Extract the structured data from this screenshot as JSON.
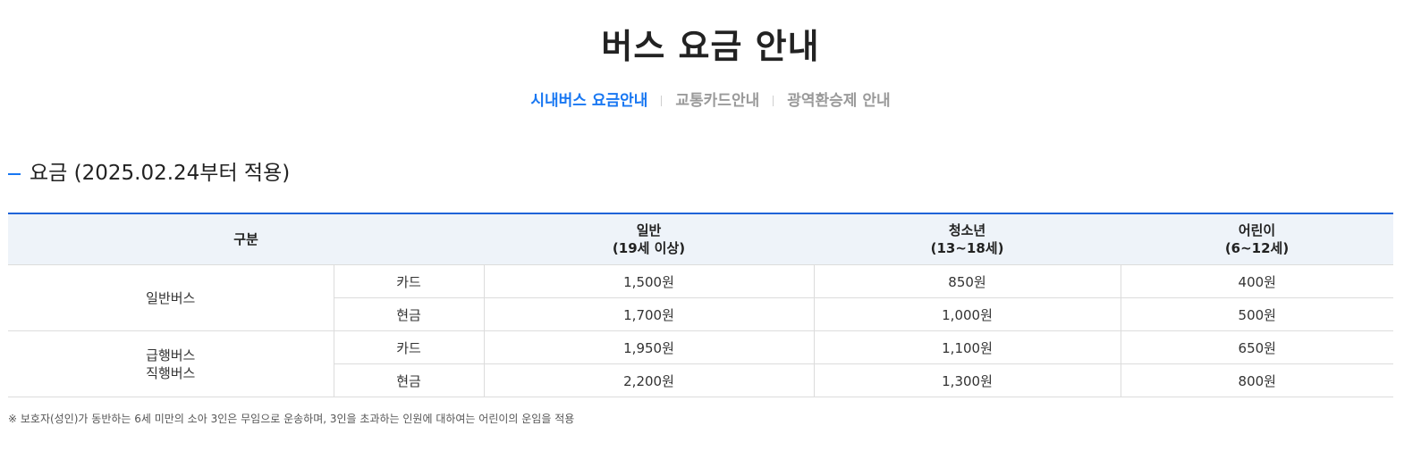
{
  "page": {
    "title": "버스 요금 안내"
  },
  "tabs": [
    {
      "label": "시내버스 요금안내",
      "active": true
    },
    {
      "label": "교통카드안내",
      "active": false
    },
    {
      "label": "광역환승제 안내",
      "active": false
    }
  ],
  "section": {
    "title": "요금 (2025.02.24부터 적용)"
  },
  "table": {
    "header": {
      "category": "구분",
      "general_line1": "일반",
      "general_line2": "(19세 이상)",
      "youth_line1": "청소년",
      "youth_line2": "(13~18세)",
      "child_line1": "어린이",
      "child_line2": "(6~12세)"
    },
    "groups": [
      {
        "label_line1": "일반버스",
        "label_line2": "",
        "rows": [
          {
            "method": "카드",
            "general": "1,500원",
            "youth": "850원",
            "child": "400원"
          },
          {
            "method": "현금",
            "general": "1,700원",
            "youth": "1,000원",
            "child": "500원"
          }
        ]
      },
      {
        "label_line1": "급행버스",
        "label_line2": "직행버스",
        "rows": [
          {
            "method": "카드",
            "general": "1,950원",
            "youth": "1,100원",
            "child": "650원"
          },
          {
            "method": "현금",
            "general": "2,200원",
            "youth": "1,300원",
            "child": "800원"
          }
        ]
      }
    ]
  },
  "note": "※ 보호자(성인)가 동반하는 6세 미만의 소아 3인은 무임으로 운송하며, 3인을 초과하는 인원에 대하여는 어린이의 운임을 적용",
  "colors": {
    "accent": "#1877f2",
    "header_bg": "#eef3f9",
    "table_top_border": "#1f63d8"
  }
}
